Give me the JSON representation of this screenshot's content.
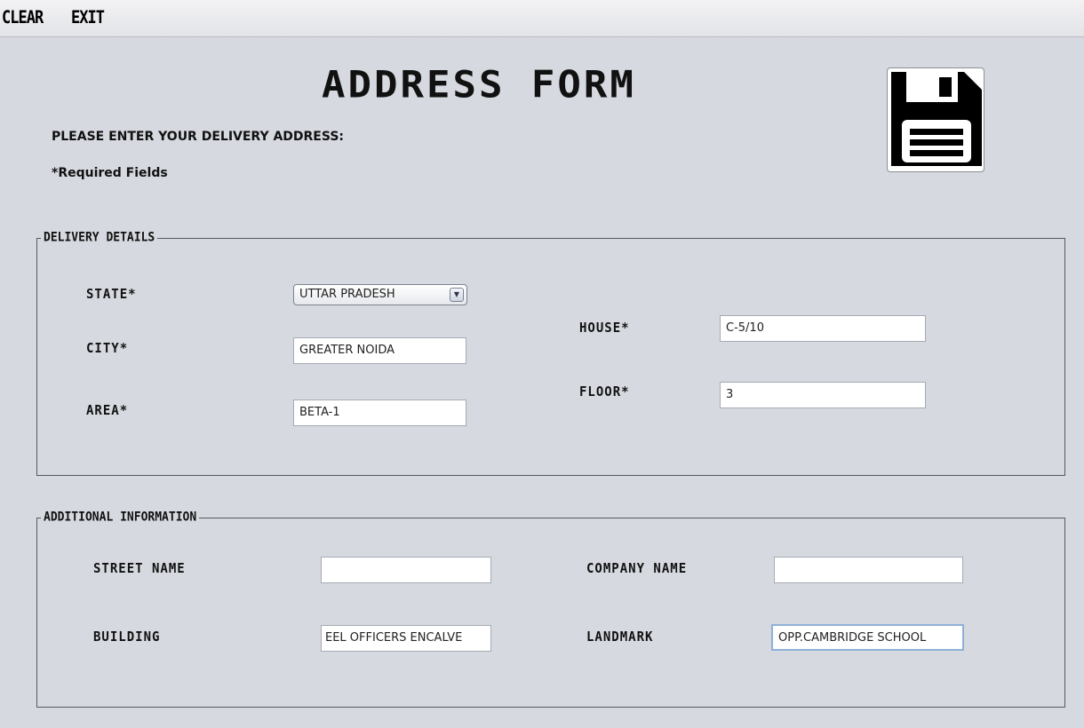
{
  "menubar": {
    "clear_label": "CLEAR",
    "exit_label": "EXIT"
  },
  "header": {
    "title": "ADDRESS FORM",
    "instruction": "PLEASE ENTER YOUR DELIVERY ADDRESS:",
    "required_note": "*Required Fields",
    "save_icon": "floppy-disk-icon"
  },
  "delivery": {
    "legend": "DELIVERY DETAILS",
    "state": {
      "label": "STATE*",
      "value": "UTTAR PRADESH"
    },
    "city": {
      "label": "CITY*",
      "value": "GREATER NOIDA"
    },
    "area": {
      "label": "AREA*",
      "value": "BETA-1"
    },
    "house": {
      "label": "HOUSE*",
      "value": "C-5/10"
    },
    "floor": {
      "label": "FLOOR*",
      "value": "3"
    }
  },
  "additional": {
    "legend": "ADDITIONAL INFORMATION",
    "street": {
      "label": "STREET NAME",
      "value": ""
    },
    "company": {
      "label": "COMPANY NAME",
      "value": ""
    },
    "building": {
      "label": "BUILDING",
      "value": "EEL OFFICERS ENCALVE"
    },
    "landmark": {
      "label": "LANDMARK",
      "value": "OPP.CAMBRIDGE SCHOOL"
    }
  }
}
